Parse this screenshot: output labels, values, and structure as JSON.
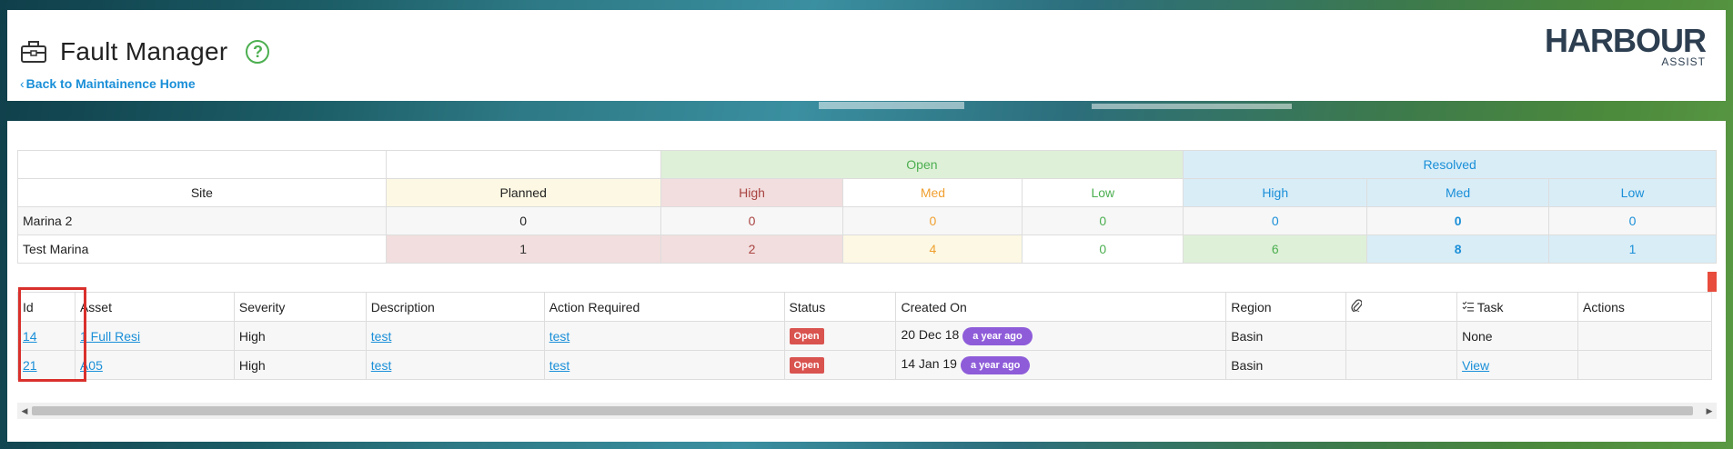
{
  "header": {
    "title": "Fault Manager",
    "title_icon": "toolbox-icon",
    "help_icon": "question-circle-icon",
    "back_link": "Back to Maintainence Home",
    "logo_main": "HARBOUR",
    "logo_sub": "ASSIST"
  },
  "summary": {
    "group_headers": {
      "open": "Open",
      "resolved": "Resolved"
    },
    "columns": [
      "Site",
      "Planned",
      "High",
      "Med",
      "Low",
      "High",
      "Med",
      "Low"
    ],
    "rows": [
      {
        "site": "Marina 2",
        "planned": "0",
        "open_high": "0",
        "open_med": "0",
        "open_low": "0",
        "res_high": "0",
        "res_med": "0",
        "res_low": "0"
      },
      {
        "site": "Test Marina",
        "planned": "1",
        "open_high": "2",
        "open_med": "4",
        "open_low": "0",
        "res_high": "6",
        "res_med": "8",
        "res_low": "1"
      }
    ]
  },
  "faults": {
    "columns": {
      "id": "Id",
      "asset": "Asset",
      "severity": "Severity",
      "description": "Description",
      "action": "Action Required",
      "status": "Status",
      "created": "Created On",
      "region": "Region",
      "attach_icon": "paperclip-icon",
      "task": "Task",
      "task_icon": "checklist-icon",
      "actions": "Actions"
    },
    "rows": [
      {
        "id": "14",
        "asset": "1 Full Resi",
        "severity": "High",
        "description": "test",
        "action": "test",
        "status": "Open",
        "created": "20 Dec 18",
        "age": "a year ago",
        "region": "Basin",
        "task": "None"
      },
      {
        "id": "21",
        "asset": "A05",
        "severity": "High",
        "description": "test",
        "action": "test",
        "status": "Open",
        "created": "14 Jan 19",
        "age": "a year ago",
        "region": "Basin",
        "task": "View"
      }
    ]
  },
  "colors": {
    "accent_link": "#1a8fd8",
    "open_badge": "#d9534f",
    "age_badge": "#8e5cd9",
    "highlight": "#d9302c"
  }
}
